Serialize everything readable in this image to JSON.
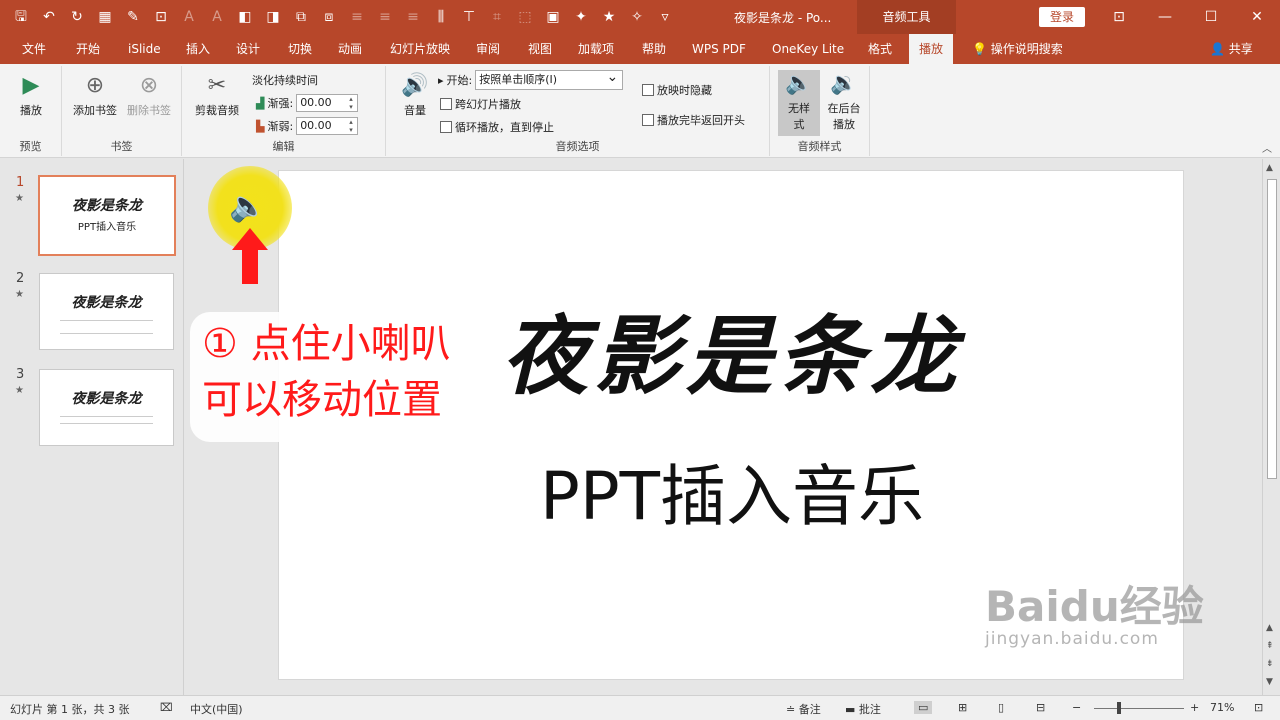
{
  "titlebar": {
    "title": "夜影是条龙 - Po...",
    "context_tools": "音频工具",
    "login": "登录"
  },
  "tabs": [
    "文件",
    "开始",
    "iSlide",
    "插入",
    "设计",
    "切换",
    "动画",
    "幻灯片放映",
    "审阅",
    "视图",
    "加载项",
    "帮助",
    "WPS PDF",
    "OneKey Lite",
    "格式",
    "播放"
  ],
  "active_tab": "播放",
  "tell_me": "操作说明搜索",
  "share": "共享",
  "ribbon": {
    "preview": {
      "play": "播放",
      "group": "预览"
    },
    "bookmarks": {
      "add": "添加书签",
      "remove": "删除书签",
      "group": "书签"
    },
    "editing": {
      "trim": "剪裁音频",
      "fade_title": "淡化持续时间",
      "fade_in_label": "渐强:",
      "fade_in_value": "00.00",
      "fade_out_label": "渐弱:",
      "fade_out_value": "00.00",
      "group": "编辑"
    },
    "audio_options": {
      "volume": "音量",
      "start_label": "开始:",
      "start_value": "按照单击顺序(I)",
      "across_slides": "跨幻灯片播放",
      "loop": "循环播放，直到停止",
      "hide_during_show": "放映时隐藏",
      "rewind": "播放完毕返回开头",
      "group": "音频选项"
    },
    "audio_styles": {
      "no_style": "无样式",
      "bg_play": "在后台播放",
      "group": "音频样式"
    }
  },
  "thumbnails": [
    {
      "num": "1",
      "title": "夜影是条龙",
      "subtitle": "PPT插入音乐"
    },
    {
      "num": "2",
      "title": "夜影是条龙",
      "subtitle": ""
    },
    {
      "num": "3",
      "title": "夜影是条龙",
      "subtitle": ""
    }
  ],
  "slide": {
    "title": "夜影是条龙",
    "subtitle": "PPT插入音乐"
  },
  "annotation": {
    "line1": "① 点住小喇叭",
    "line2": "可以移动位置"
  },
  "watermark": {
    "brand": "Baidu经验",
    "url": "jingyan.baidu.com"
  },
  "statusbar": {
    "slide_info": "幻灯片 第 1 张，共 3 张",
    "language": "中文(中国)",
    "notes": "备注",
    "comments": "批注",
    "zoom": "71%"
  },
  "colors": {
    "accent": "#b7472a",
    "annotation": "#ff1a1a",
    "highlight": "#f3e21a"
  }
}
